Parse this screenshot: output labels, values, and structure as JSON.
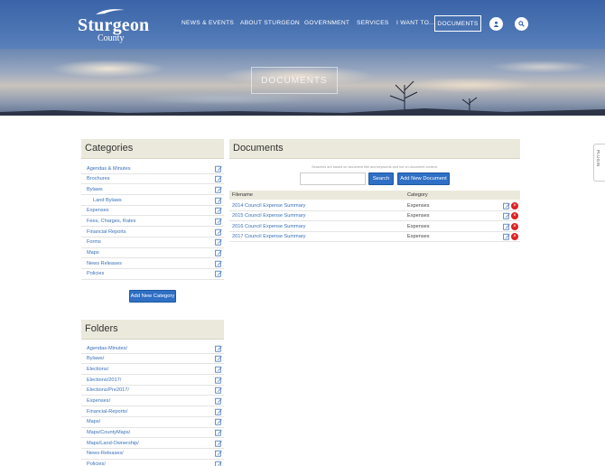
{
  "brand": {
    "name": "Sturgeon",
    "sub": "County"
  },
  "nav": {
    "items": [
      "NEWS & EVENTS",
      "ABOUT STURGEON",
      "GOVERNMENT",
      "SERVICES",
      "I WANT TO..."
    ],
    "active": "DOCUMENTS",
    "icons": [
      "user-icon",
      "search-icon"
    ]
  },
  "hero": {
    "title": "DOCUMENTS"
  },
  "categories": {
    "title": "Categories",
    "items": [
      {
        "label": "Agendas & Minutes",
        "indent": false
      },
      {
        "label": "Brochures",
        "indent": false
      },
      {
        "label": "Bylaws",
        "indent": false
      },
      {
        "label": "Land Bylaws",
        "indent": true
      },
      {
        "label": "Expenses",
        "indent": false
      },
      {
        "label": "Fees, Charges, Rates",
        "indent": false
      },
      {
        "label": "Financial Reports",
        "indent": false
      },
      {
        "label": "Forms",
        "indent": false
      },
      {
        "label": "Maps",
        "indent": false
      },
      {
        "label": "News Releases",
        "indent": false
      },
      {
        "label": "Policies",
        "indent": false
      }
    ],
    "add_button": "Add New Category"
  },
  "folders": {
    "title": "Folders",
    "items": [
      "Agendas-Minutes/",
      "Bylaws/",
      "Elections/",
      "Elections/2017/",
      "Elections/Pre2017/",
      "Expenses/",
      "Financial-Reports/",
      "Maps/",
      "Maps/CountyMaps/",
      "Maps/Land-Ownership/",
      "News-Releases/",
      "Policies/"
    ]
  },
  "documents": {
    "title": "Documents",
    "hint": "Searches are based on document title and keywords and not on document content.",
    "search_placeholder": "",
    "search_button": "Search",
    "add_button": "Add New Document",
    "columns": [
      "Filename",
      "Category"
    ],
    "rows": [
      {
        "filename": "2014 Council Expense Summary",
        "category": "Expenses"
      },
      {
        "filename": "2015 Council Expense Summary",
        "category": "Expenses"
      },
      {
        "filename": "2016 Council Expense Summary",
        "category": "Expenses"
      },
      {
        "filename": "2017 Council Expense Summary",
        "category": "Expenses"
      }
    ]
  },
  "plugin_tab": "PLUGIN",
  "colors": {
    "header": "#3a64a7",
    "link": "#3a70b8",
    "button": "#2f6fc4",
    "panel": "#ebe9dc",
    "delete": "#dd2222"
  }
}
